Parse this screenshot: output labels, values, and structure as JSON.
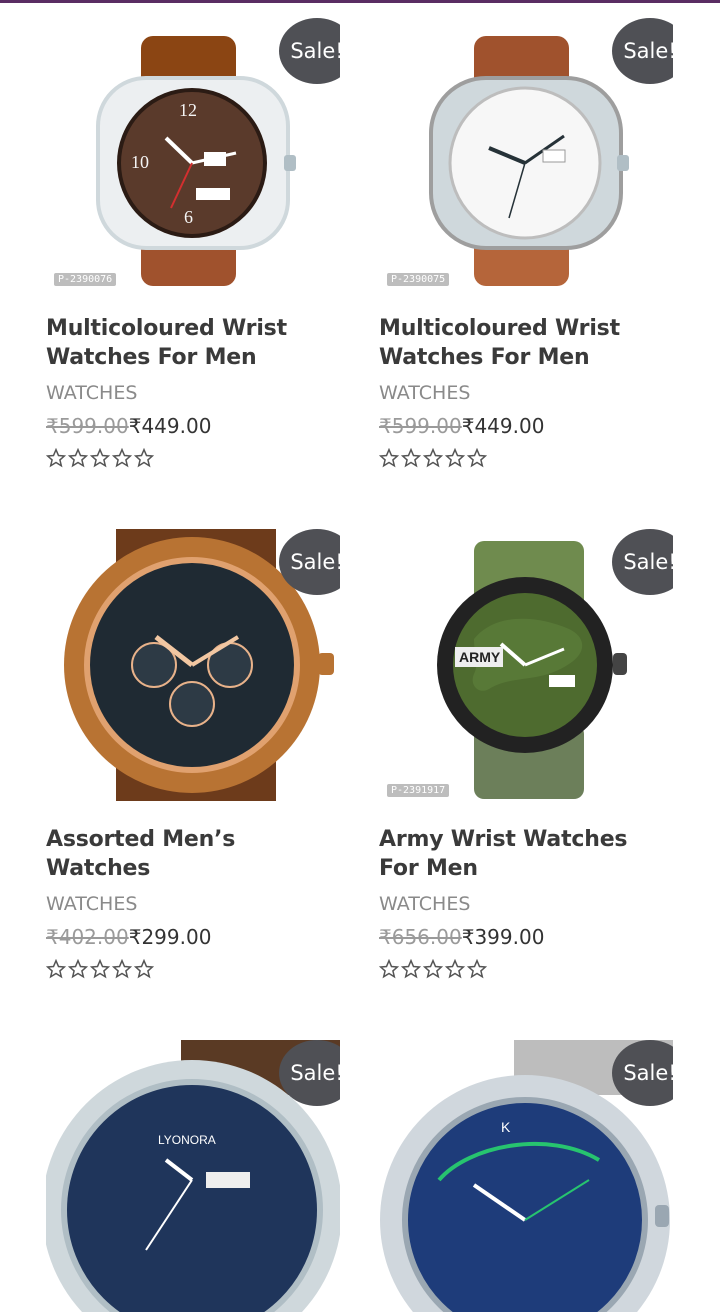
{
  "products": [
    {
      "title": "Multicoloured Wrist Watches For Men",
      "category": "WATCHES",
      "old_price": "₹599.00",
      "new_price": "₹449.00",
      "sale": "Sale!",
      "code": "P-2390076"
    },
    {
      "title": "Multicoloured Wrist Watches For Men",
      "category": "WATCHES",
      "old_price": "₹599.00",
      "new_price": "₹449.00",
      "sale": "Sale!",
      "code": "P-2390075"
    },
    {
      "title": "Assorted Men’s Watches",
      "category": "WATCHES",
      "old_price": "₹402.00",
      "new_price": "₹299.00",
      "sale": "Sale!",
      "code": ""
    },
    {
      "title": "Army Wrist Watches For Men",
      "category": "WATCHES",
      "old_price": "₹656.00",
      "new_price": "₹399.00",
      "sale": "Sale!",
      "code": "P-2391917"
    },
    {
      "title": "",
      "category": "",
      "old_price": "",
      "new_price": "",
      "sale": "Sale!",
      "code": ""
    },
    {
      "title": "",
      "category": "",
      "old_price": "",
      "new_price": "",
      "sale": "Sale!",
      "code": ""
    }
  ],
  "colors": {
    "sale_badge": "#4f5055",
    "accent_bar": "#5a2d63"
  },
  "icons": {
    "rating": "star-outline-icon"
  }
}
